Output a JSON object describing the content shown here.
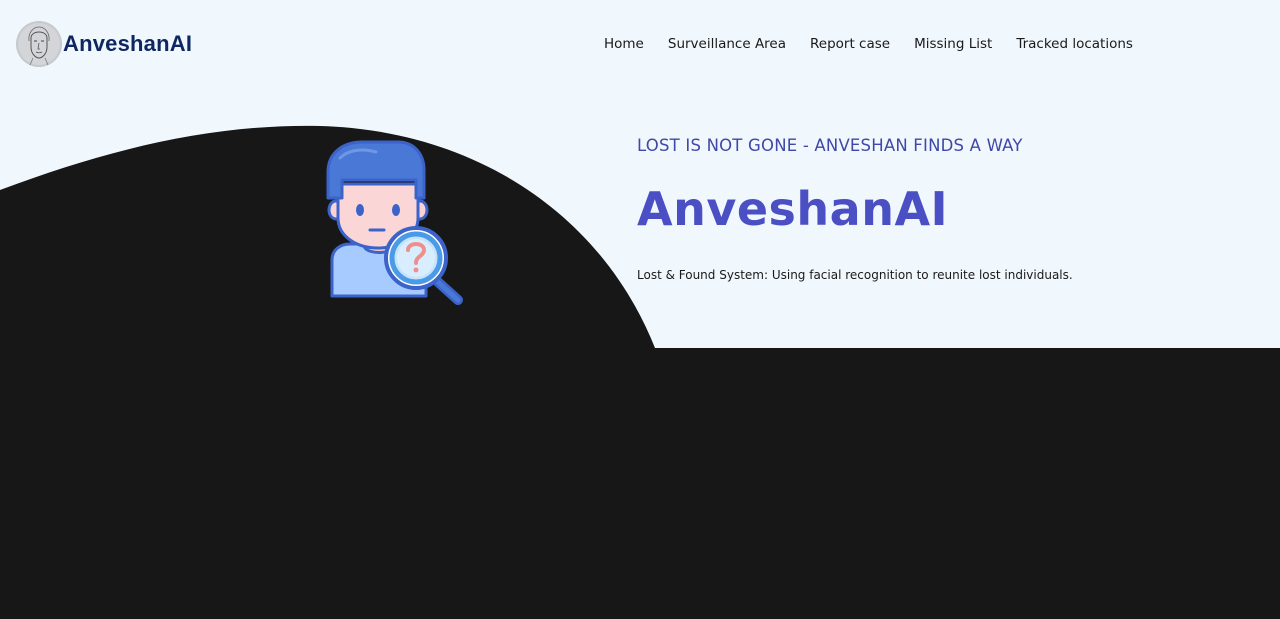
{
  "brand": {
    "name": "AnveshanAI",
    "logo_icon": "face-sketch-icon"
  },
  "nav": {
    "items": [
      {
        "label": "Home"
      },
      {
        "label": "Surveillance Area"
      },
      {
        "label": "Report case"
      },
      {
        "label": "Missing List"
      },
      {
        "label": "Tracked locations"
      }
    ]
  },
  "hero": {
    "tagline": "LOST IS NOT GONE - ANVESHAN FINDS A WAY",
    "title": "AnveshanAI",
    "description": "Lost & Found System: Using facial recognition to reunite lost individuals.",
    "illustration_icon": "missing-person-search-icon"
  },
  "colors": {
    "background": "#f0f7fd",
    "dark_section": "#171717",
    "brand_text": "#0f2761",
    "accent": "#4b4fc4",
    "tagline": "#3f48a8"
  }
}
